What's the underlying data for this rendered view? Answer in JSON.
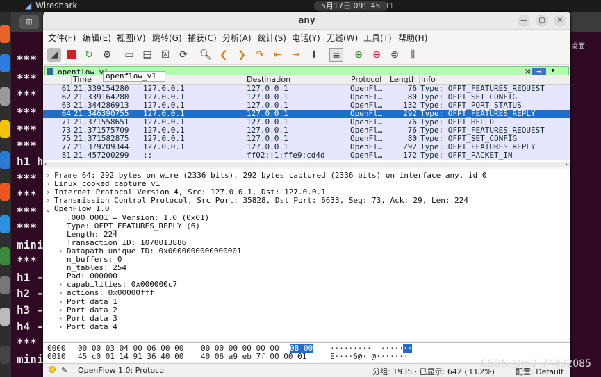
{
  "os": {
    "app_name": "Wireshark",
    "clock": "5月17日 09：45"
  },
  "terminal": {
    "lines": [
      "***",
      "***",
      "***",
      "***",
      "***",
      "***",
      "h1 h",
      "***",
      "***",
      "***",
      "***",
      "mini",
      "***",
      "h1 -",
      "h2 -",
      "h3 -",
      "h4 -",
      "***",
      "mini"
    ],
    "right_text": "桌面"
  },
  "window": {
    "title": "any"
  },
  "menu": [
    "文件(F)",
    "编辑(E)",
    "视图(V)",
    "跳转(G)",
    "捕获(C)",
    "分析(A)",
    "统计(S)",
    "电话(Y)",
    "无线(W)",
    "工具(T)",
    "帮助(H)"
  ],
  "filter": {
    "value": "openflow_v1",
    "suggestion": "openflow_v1"
  },
  "columns": [
    "Time",
    "e",
    "Destination",
    "Protocol",
    "Length",
    "Info"
  ],
  "packets": [
    {
      "no": "61",
      "time": "21.339154280",
      "src": "127.0.0.1",
      "dst": "127.0.0.1",
      "proto": "OpenFl…",
      "len": "76",
      "info": "Type: OFPT_FEATURES_REQUEST"
    },
    {
      "no": "62",
      "time": "21.339164280",
      "src": "127.0.0.1",
      "dst": "127.0.0.1",
      "proto": "OpenFl…",
      "len": "80",
      "info": "Type: OFPT_SET_CONFIG"
    },
    {
      "no": "63",
      "time": "21.344286913",
      "src": "127.0.0.1",
      "dst": "127.0.0.1",
      "proto": "OpenFl…",
      "len": "132",
      "info": "Type: OFPT_PORT_STATUS"
    },
    {
      "no": "64",
      "time": "21.346390755",
      "src": "127.0.0.1",
      "dst": "127.0.0.1",
      "proto": "OpenFl…",
      "len": "292",
      "info": "Type: OFPT_FEATURES_REPLY"
    },
    {
      "no": "71",
      "time": "21.371558651",
      "src": "127.0.0.1",
      "dst": "127.0.0.1",
      "proto": "OpenFl…",
      "len": "76",
      "info": "Type: OFPT_HELLO"
    },
    {
      "no": "73",
      "time": "21.371575709",
      "src": "127.0.0.1",
      "dst": "127.0.0.1",
      "proto": "OpenFl…",
      "len": "76",
      "info": "Type: OFPT_FEATURES_REQUEST"
    },
    {
      "no": "75",
      "time": "21.371582875",
      "src": "127.0.0.1",
      "dst": "127.0.0.1",
      "proto": "OpenFl…",
      "len": "80",
      "info": "Type: OFPT_SET_CONFIG"
    },
    {
      "no": "77",
      "time": "21.379209344",
      "src": "127.0.0.1",
      "dst": "127.0.0.1",
      "proto": "OpenFl…",
      "len": "292",
      "info": "Type: OFPT_FEATURES_REPLY"
    },
    {
      "no": "81",
      "time": "21.457200299",
      "src": "::",
      "dst": "ff02::1:ffe9:cd4d",
      "proto": "OpenFl…",
      "len": "172",
      "info": "Type: OFPT_PACKET_IN"
    }
  ],
  "details": [
    {
      "arrow": "›",
      "text": "Frame 64: 292 bytes on wire (2336 bits), 292 bytes captured (2336 bits) on interface any, id 0"
    },
    {
      "arrow": "›",
      "text": "Linux cooked capture v1"
    },
    {
      "arrow": "›",
      "text": "Internet Protocol Version 4, Src: 127.0.0.1, Dst: 127.0.0.1"
    },
    {
      "arrow": "›",
      "text": "Transmission Control Protocol, Src Port: 35828, Dst Port: 6633, Seq: 73, Ack: 29, Len: 224"
    },
    {
      "arrow": "⌄",
      "text": "OpenFlow 1.0"
    },
    {
      "arrow": "",
      "text": ".000 0001 = Version: 1.0 (0x01)"
    },
    {
      "arrow": "",
      "text": "Type: OFPT_FEATURES_REPLY (6)"
    },
    {
      "arrow": "",
      "text": "Length: 224"
    },
    {
      "arrow": "",
      "text": "Transaction ID: 1070013886"
    },
    {
      "arrow": "›",
      "text": "Datapath unique ID: 0x0000000000000001"
    },
    {
      "arrow": "",
      "text": "n_buffers: 0"
    },
    {
      "arrow": "",
      "text": "n_tables: 254"
    },
    {
      "arrow": "",
      "text": "Pad: 000000"
    },
    {
      "arrow": "›",
      "text": "capabilities: 0x000000c7"
    },
    {
      "arrow": "›",
      "text": "actions: 0x00000fff"
    },
    {
      "arrow": "›",
      "text": "Port data 1"
    },
    {
      "arrow": "›",
      "text": "Port data 2"
    },
    {
      "arrow": "›",
      "text": "Port data 3"
    },
    {
      "arrow": "›",
      "text": "Port data 4"
    }
  ],
  "bytes": [
    {
      "offset": "0000",
      "hex_a": "00 00 03 04 00 06 00 00",
      "hex_b": "00 00 00 00 00 00",
      "hex_sel": "08 00",
      "ascii": "·········  ······",
      "ascii_sel": "··"
    },
    {
      "offset": "0010",
      "hex_a": "45 c0 01 14 91 36 40 00",
      "hex_b": "40 06 a9 eb 7f 00 00 01",
      "hex_sel": "",
      "ascii": "E····6@· @·······",
      "ascii_sel": ""
    }
  ],
  "status": {
    "protocol": "OpenFlow 1.0: Protocol",
    "packets": "分组: 1935 · 已显示: 642 (33.2%)",
    "profile": "配置: Default"
  },
  "watermark": "CSDN @m0_74432085"
}
